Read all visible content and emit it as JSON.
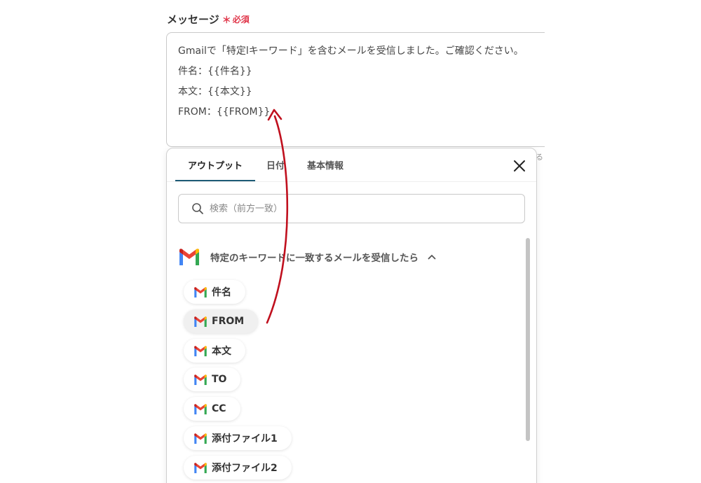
{
  "form": {
    "label": "メッセージ",
    "required_mark": "＊",
    "required_text": "必須",
    "message_lines": [
      "Gmailで「特定lキーワード」を含むメールを受信しました。ご確認ください。",
      "件名：{{件名}}",
      "本文：{{本文}}",
      "FROM：{{FROM}}"
    ],
    "edge_text": "る"
  },
  "panel": {
    "tabs": [
      {
        "label": "アウトプット",
        "active": true
      },
      {
        "label": "日付",
        "active": false
      },
      {
        "label": "基本情報",
        "active": false
      }
    ],
    "search_placeholder": "検索（前方一致）",
    "group_title": "特定のキーワードに一致するメールを受信したら",
    "items": [
      {
        "label": "件名"
      },
      {
        "label": "FROM",
        "hover": true
      },
      {
        "label": "本文"
      },
      {
        "label": "TO"
      },
      {
        "label": "CC"
      },
      {
        "label": "添付ファイル1"
      },
      {
        "label": "添付ファイル2"
      }
    ]
  },
  "colors": {
    "accent": "#1d5b75",
    "required": "#e0364a",
    "arrow": "#c0101e"
  },
  "icons": [
    "gmail-icon",
    "search-icon",
    "close-icon",
    "chevron-up-icon"
  ]
}
